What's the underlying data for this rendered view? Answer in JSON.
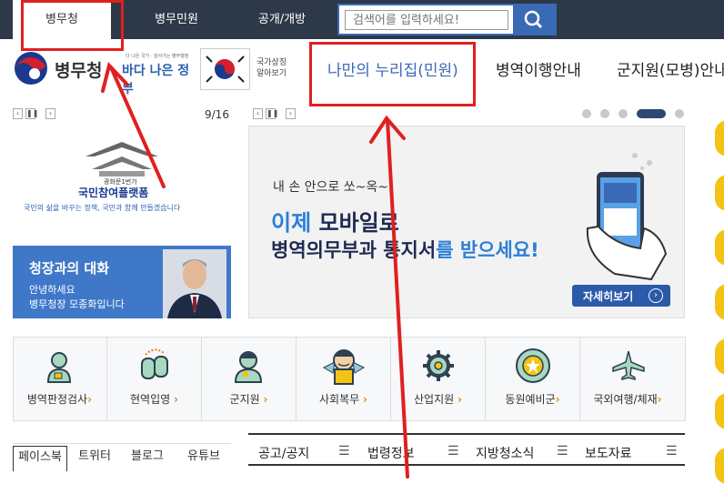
{
  "top_tabs": [
    "병무청",
    "병무민원",
    "공개/개방"
  ],
  "search": {
    "placeholder": "검색어를 입력하세요!"
  },
  "logo": {
    "title": "병무청",
    "slogan": "바다 나은 정부",
    "slogan_sub": "더 나은 국가 · 앞서가는 병무행정"
  },
  "national_symbol": {
    "line1": "국가상징",
    "line2": "알아보기"
  },
  "gnb": [
    "나만의 누리집(민원)",
    "병역이행안내",
    "군지원(모병)안내"
  ],
  "left_banner": {
    "counter": "9/16",
    "gate_caption": "광화문1번가",
    "platform_title": "국민참여플랫폼",
    "platform_desc": "국민의 삶을 바꾸는 정책, 국민과 함께 만들겠습니다"
  },
  "commissioner": {
    "title": "청장과의 대화",
    "line1": "안녕하세요",
    "line2": "병무청장 모종화입니다"
  },
  "main_banner": {
    "line1": "내 손 안으로 쏘~옥~",
    "line2_blue": "이제 ",
    "line2_dark": "모바일로",
    "line3_dark": "병역의무부과 통지서",
    "line3_blue": "를 받으세요!",
    "more_button": "자세히보기"
  },
  "quick_menu": [
    {
      "label": "병역판정검사",
      "icon": "person-icon"
    },
    {
      "label": "현역입영",
      "icon": "dogtag-icon"
    },
    {
      "label": "군지원",
      "icon": "soldier-icon"
    },
    {
      "label": "사회복무",
      "icon": "mascot-icon"
    },
    {
      "label": "산업지원",
      "icon": "gear-icon"
    },
    {
      "label": "동원예비군",
      "icon": "emblem-icon"
    },
    {
      "label": "국외여행/체재",
      "icon": "airplane-icon"
    }
  ],
  "sns_tabs": [
    "페이스북",
    "트위터",
    "블로그",
    "유튜브"
  ],
  "notice_tabs": [
    "공고/공지",
    "법령정보",
    "지방청소식",
    "보도자료"
  ],
  "colors": {
    "topbar": "#2d3848",
    "accent_blue": "#3a6ab5",
    "annotation_red": "#e02020",
    "icon_orange": "#f07f00"
  }
}
